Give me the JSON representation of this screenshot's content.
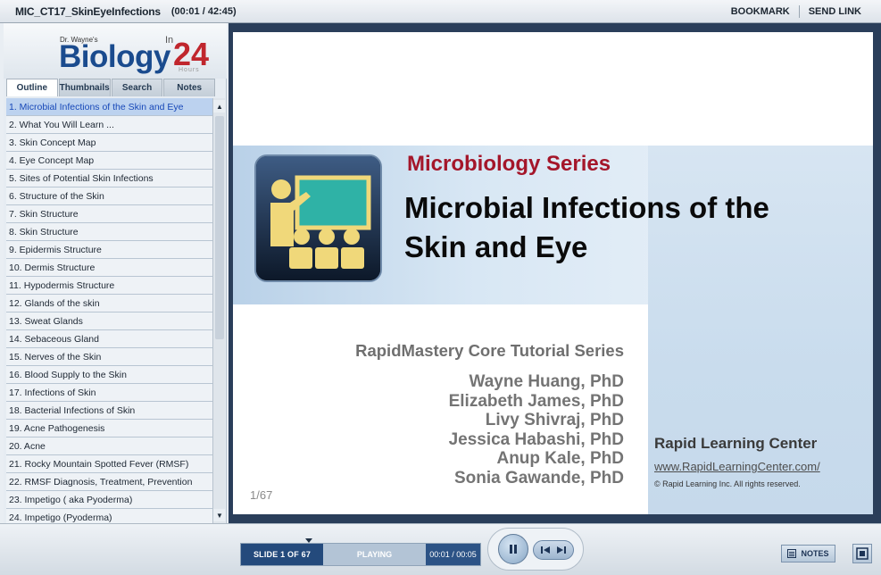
{
  "titlebar": {
    "title": "MIC_CT17_SkinEyeInfections",
    "time": "(00:01 / 42:45)",
    "bookmark_label": "BOOKMARK",
    "send_link_label": "SEND LINK"
  },
  "logo": {
    "prefix": "Dr. Wayne's",
    "main": "Biology",
    "in": "In",
    "number": "24",
    "suffix": "Hours"
  },
  "tabs": [
    {
      "label": "Outline"
    },
    {
      "label": "Thumbnails"
    },
    {
      "label": "Search"
    },
    {
      "label": "Notes"
    }
  ],
  "outline": [
    {
      "label": "1. Microbial Infections of the Skin and Eye"
    },
    {
      "label": "2. What You Will Learn ..."
    },
    {
      "label": "3. Skin Concept Map"
    },
    {
      "label": "4. Eye Concept Map"
    },
    {
      "label": "5. Sites of Potential Skin Infections"
    },
    {
      "label": "6. Structure of the Skin"
    },
    {
      "label": "7. Skin Structure"
    },
    {
      "label": "8. Skin Structure"
    },
    {
      "label": "9. Epidermis Structure"
    },
    {
      "label": "10. Dermis Structure"
    },
    {
      "label": "11. Hypodermis Structure"
    },
    {
      "label": "12. Glands of the skin"
    },
    {
      "label": "13. Sweat Glands"
    },
    {
      "label": "14. Sebaceous Gland"
    },
    {
      "label": "15. Nerves of the Skin"
    },
    {
      "label": "16. Blood Supply to the Skin"
    },
    {
      "label": "17. Infections of Skin"
    },
    {
      "label": "18. Bacterial Infections of Skin"
    },
    {
      "label": "19. Acne Pathogenesis"
    },
    {
      "label": "20. Acne"
    },
    {
      "label": "21. Rocky Mountain Spotted Fever (RMSF)"
    },
    {
      "label": "22. RMSF Diagnosis, Treatment, Prevention"
    },
    {
      "label": "23. Impetigo ( aka Pyoderma)"
    },
    {
      "label": "24. Impetigo (Pyoderma)"
    }
  ],
  "slide": {
    "series": "Microbiology Series",
    "title_line1": "Microbial Infections of the",
    "title_line2": "Skin and Eye",
    "core_series": "RapidMastery Core Tutorial Series",
    "authors": [
      "Wayne Huang, PhD",
      "Elizabeth James, PhD",
      "Livy Shivraj, PhD",
      "Jessica Habashi, PhD",
      "Anup Kale, PhD",
      "Sonia Gawande, PhD"
    ],
    "page": "1/67",
    "center_name": "Rapid Learning Center",
    "url": "www.RapidLearningCenter.com/",
    "copyright": "© Rapid Learning Inc. All rights reserved."
  },
  "player": {
    "slide_count": "SLIDE 1 OF 67",
    "state": "PLAYING",
    "elapsed": "00:01 / 00:05",
    "notes_label": "NOTES"
  },
  "colors": {
    "selected_item": "#bcd2ef",
    "series_red": "#a4162a",
    "brand_blue": "#1a4b8e"
  }
}
